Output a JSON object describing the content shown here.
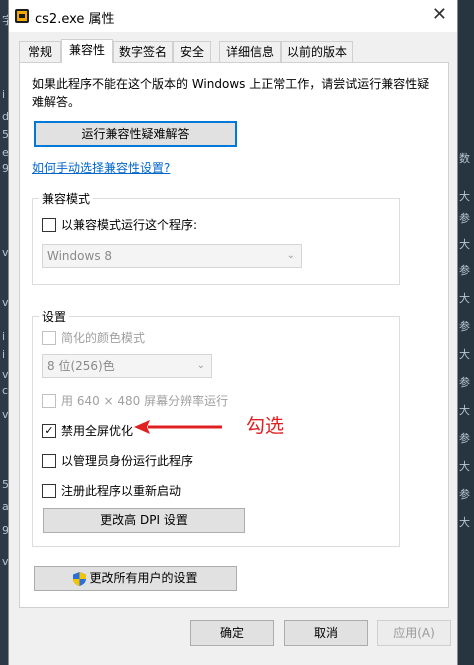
{
  "window": {
    "title": "cs2.exe 属性",
    "close_glyph": "✕"
  },
  "tabs": [
    {
      "label": "常规"
    },
    {
      "label": "兼容性"
    },
    {
      "label": "数字签名"
    },
    {
      "label": "安全"
    },
    {
      "label": "详细信息"
    },
    {
      "label": "以前的版本"
    }
  ],
  "intro_text": "如果此程序不能在这个版本的 Windows 上正常工作，请尝试运行兼容性疑难解答。",
  "troubleshoot_button": "运行兼容性疑难解答",
  "manual_link": "如何手动选择兼容性设置?",
  "compat_mode": {
    "group_label": "兼容模式",
    "checkbox_label": "以兼容模式运行这个程序:",
    "checked": false,
    "os_select": "Windows 8"
  },
  "settings": {
    "group_label": "设置",
    "reduced_color": {
      "label": "简化的颜色模式",
      "checked": false
    },
    "color_select": "8 位(256)色",
    "low_res": {
      "label": "用 640 × 480 屏幕分辨率运行",
      "checked": false
    },
    "disable_fullscreen": {
      "label": "禁用全屏优化",
      "checked": true
    },
    "run_admin": {
      "label": "以管理员身份运行此程序",
      "checked": false
    },
    "register_restart": {
      "label": "注册此程序以重新启动",
      "checked": false
    },
    "dpi_button": "更改高 DPI 设置"
  },
  "all_users_button": "更改所有用户的设置",
  "footer": {
    "ok": "确定",
    "cancel": "取消",
    "apply": "应用(A)"
  },
  "annotation": {
    "text": "勾选",
    "color": "#e02020"
  },
  "background_chars": {
    "left": [
      "字",
      "i",
      "d",
      "5",
      "e",
      "9",
      "v",
      "v",
      "i",
      "i",
      "v",
      "c",
      "v",
      "5",
      "a",
      "9",
      "v"
    ],
    "right": [
      "数",
      "大",
      "参",
      "大",
      "参",
      "大",
      "参",
      "大",
      "参",
      "大",
      "参",
      "大",
      "参",
      "大"
    ]
  },
  "check_glyph": "✓",
  "chevron_glyph": "⌄"
}
